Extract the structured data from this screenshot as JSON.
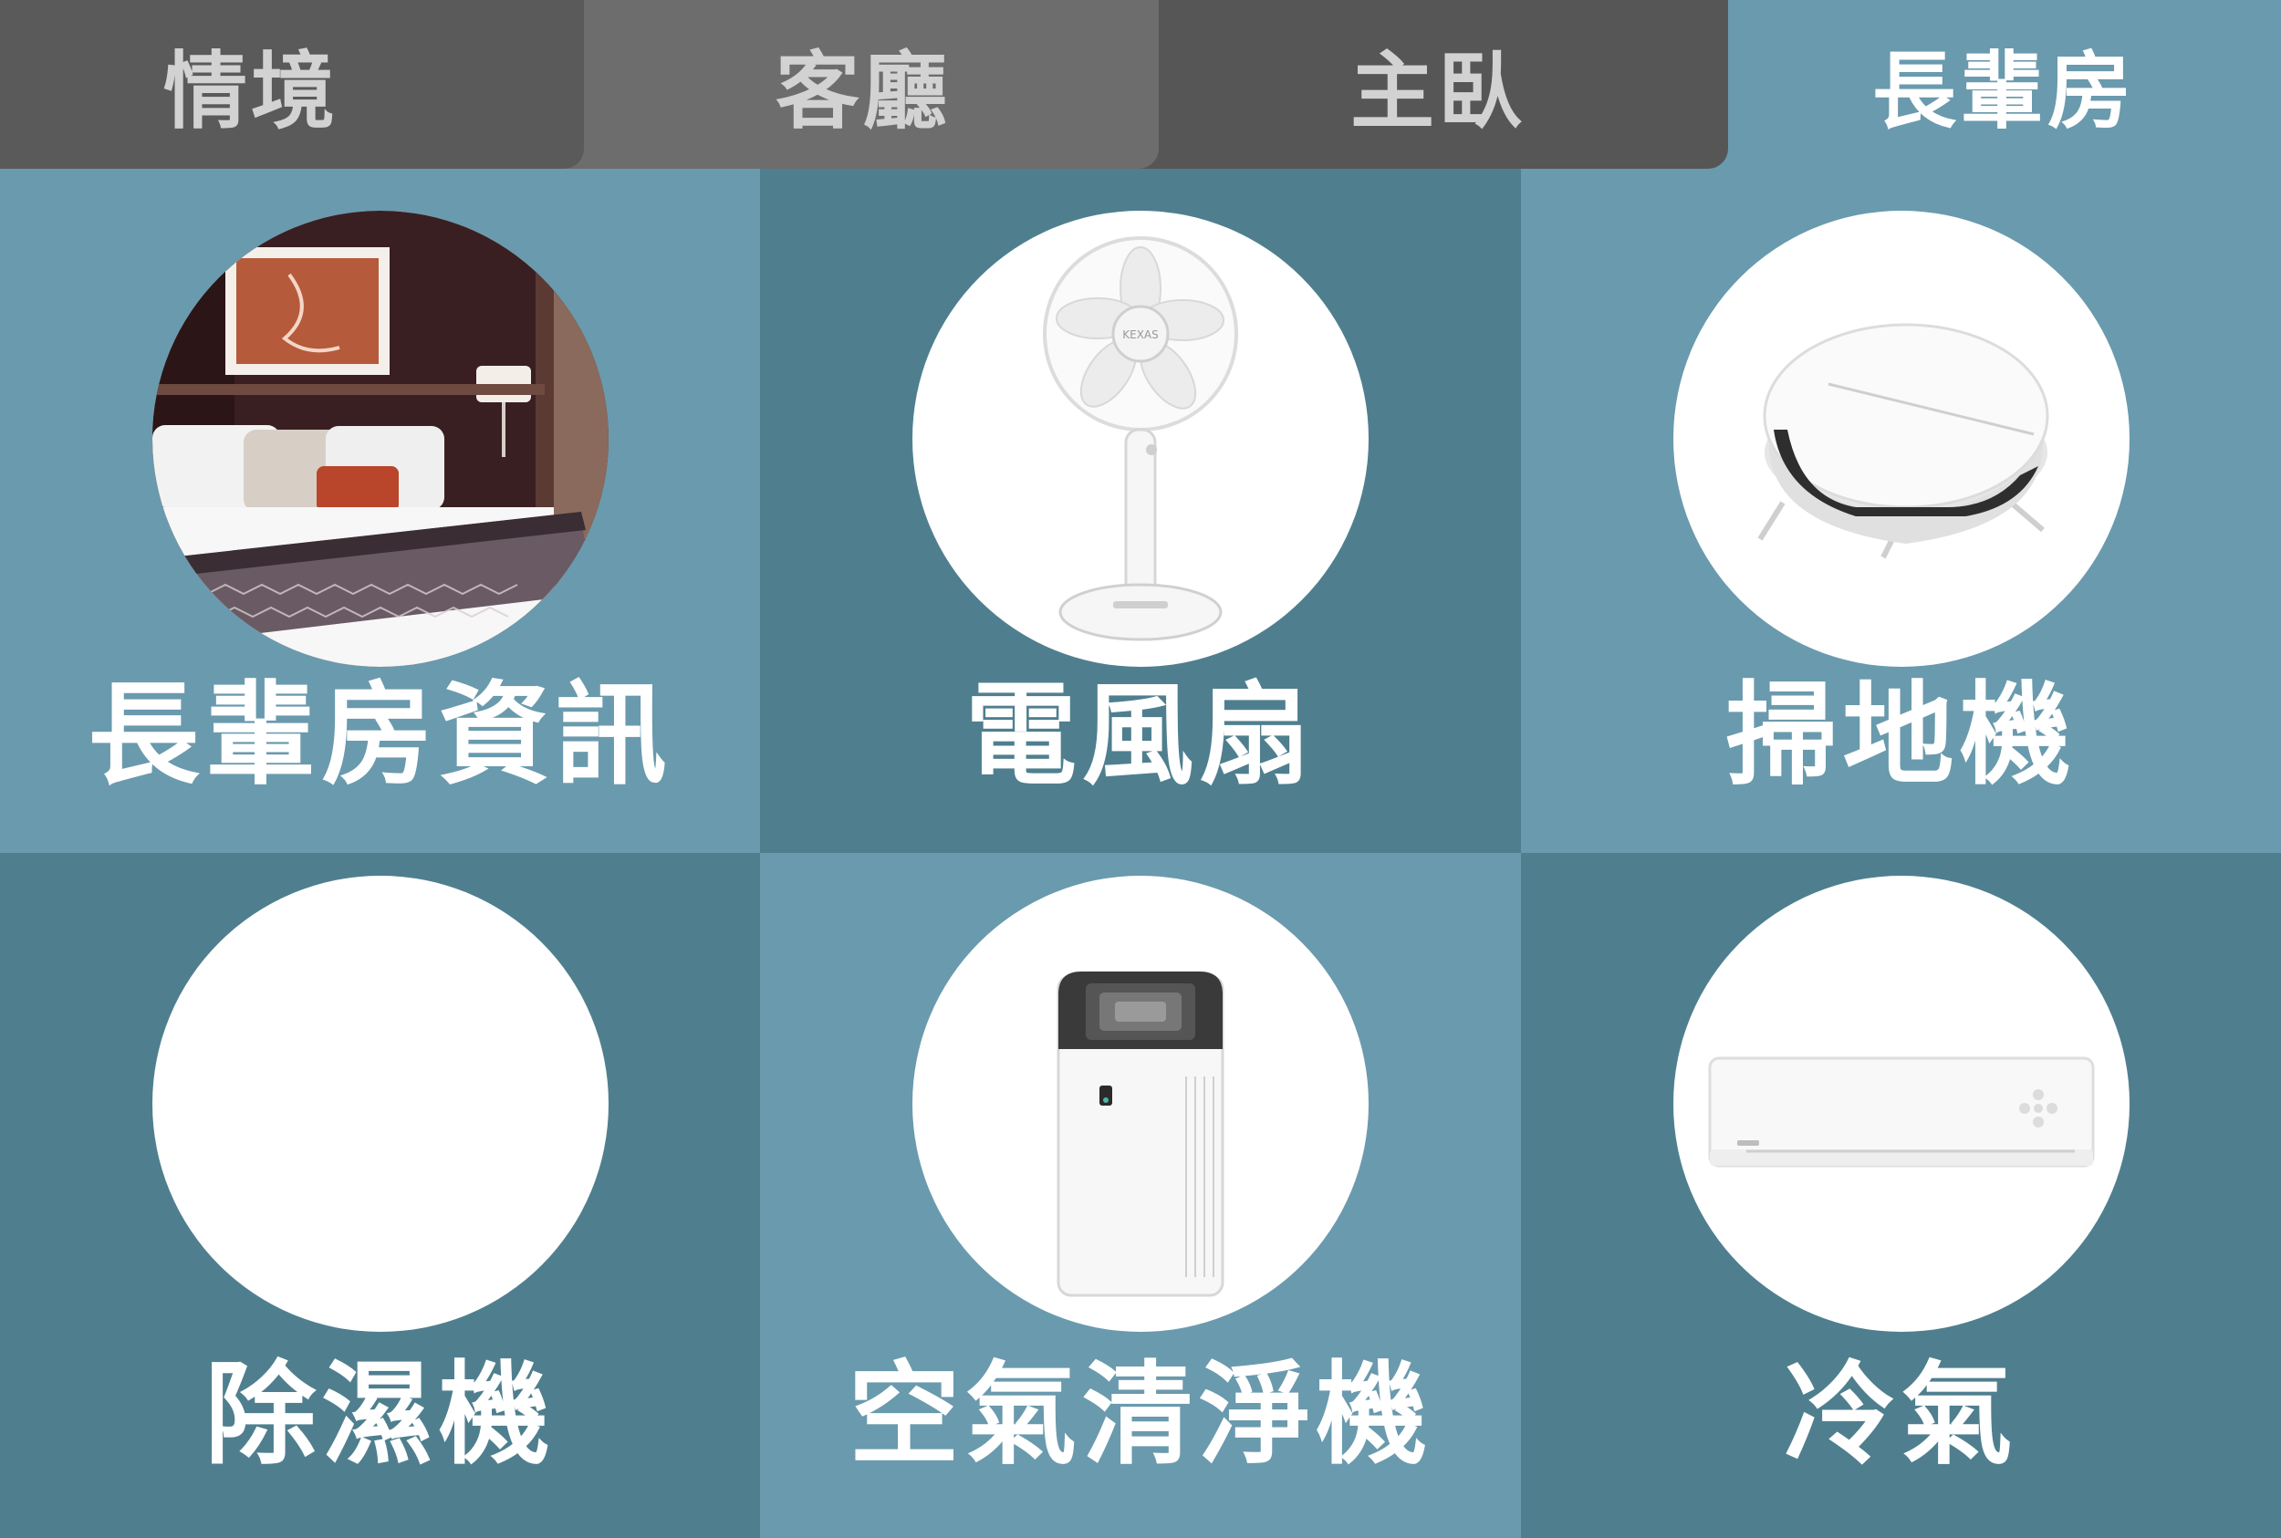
{
  "tabs": [
    {
      "label": "情境",
      "active": false
    },
    {
      "label": "客廳",
      "active": false
    },
    {
      "label": "主臥",
      "active": false
    },
    {
      "label": "長輩房",
      "active": true
    }
  ],
  "tiles": [
    {
      "label": "長輩房資訊",
      "icon": "bedroom-photo-icon"
    },
    {
      "label": "電風扇",
      "icon": "electric-fan-icon"
    },
    {
      "label": "掃地機",
      "icon": "robot-vacuum-icon"
    },
    {
      "label": "除濕機",
      "icon": "dehumidifier-icon"
    },
    {
      "label": "空氣清淨機",
      "icon": "air-purifier-icon"
    },
    {
      "label": "冷氣",
      "icon": "air-conditioner-icon"
    }
  ],
  "colors": {
    "tile_light": "#6a9aad",
    "tile_dark": "#4f7f8f",
    "tab_active_text": "#ffffff",
    "tab_inactive_text": "#d2d2d2"
  }
}
